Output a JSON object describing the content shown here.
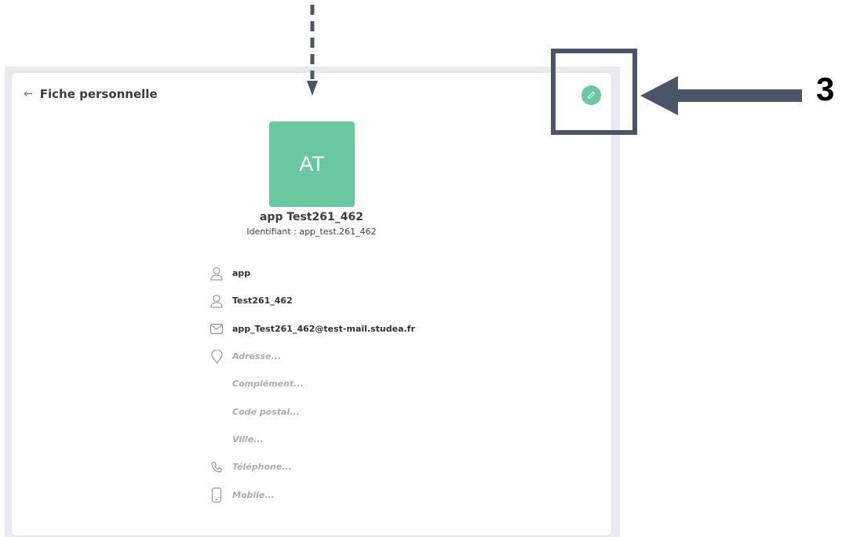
{
  "header": {
    "back_icon": "arrow-left-icon",
    "title": "Fiche personnelle",
    "edit_icon": "pencil-icon"
  },
  "profile": {
    "initials": "AT",
    "avatar_color": "#6ac8a0",
    "full_name": "app Test261_462",
    "identifier": "Identifiant : app_test.261_462"
  },
  "fields": {
    "first_name": {
      "icon": "user-icon",
      "value": "app"
    },
    "last_name": {
      "icon": "user-icon",
      "value": "Test261_462"
    },
    "email": {
      "icon": "mail-icon",
      "value": "app_Test261_462@test-mail.studea.fr"
    },
    "address": {
      "icon": "map-pin-icon",
      "placeholder": "Adresse..."
    },
    "complement": {
      "placeholder": "Complément..."
    },
    "postal_code": {
      "placeholder": "Code postal..."
    },
    "city": {
      "placeholder": "Ville..."
    },
    "phone": {
      "icon": "phone-icon",
      "placeholder": "Téléphone..."
    },
    "mobile": {
      "icon": "smartphone-icon",
      "placeholder": "Mobile..."
    }
  },
  "annotation": {
    "step_number": "3",
    "color": "#4a5568"
  }
}
